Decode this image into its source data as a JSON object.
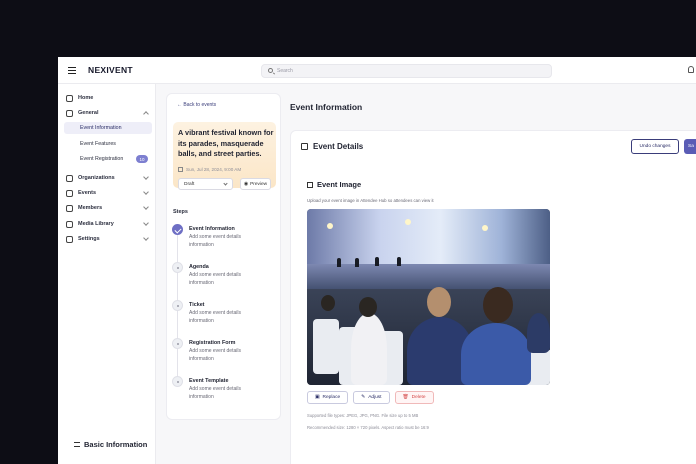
{
  "topbar": {
    "brand": "NEXIVENT",
    "search_placeholder": "Search"
  },
  "sidebar": {
    "items": [
      {
        "label": "Home",
        "icon": "home-icon"
      },
      {
        "label": "General",
        "icon": "chart-icon",
        "expanded": true
      },
      {
        "label": "Organizations",
        "icon": "building-icon"
      },
      {
        "label": "Events",
        "icon": "calendar-icon"
      },
      {
        "label": "Members",
        "icon": "users-icon"
      },
      {
        "label": "Media Library",
        "icon": "folder-icon"
      },
      {
        "label": "Settings",
        "icon": "gear-icon"
      }
    ],
    "sub_items": [
      {
        "label": "Event Information",
        "active": true
      },
      {
        "label": "Event Features"
      },
      {
        "label": "Event Registration",
        "badge": "10"
      }
    ]
  },
  "steps_panel": {
    "back_label": "Back to events",
    "hero_title": "A vibrant festival known for its parades, masquerade balls, and street parties.",
    "hero_date": "Sun, Jul 28, 2024, 9:00 AM",
    "status_value": "Draft",
    "preview_label": "Preview",
    "steps_title": "Steps",
    "steps": [
      {
        "title": "Event Information",
        "desc": "Add some event details information",
        "done": true
      },
      {
        "title": "Agenda",
        "desc": "Add some event details information",
        "done": false
      },
      {
        "title": "Ticket",
        "desc": "Add some event details information",
        "done": false
      },
      {
        "title": "Registration Form",
        "desc": "Add some event details information",
        "done": false
      },
      {
        "title": "Event Template",
        "desc": "Add some event details information",
        "done": false
      }
    ]
  },
  "main": {
    "page_title": "Event Information",
    "details_title": "Event Details",
    "undo_label": "Undo changes",
    "save_label": "Sa",
    "image_section": {
      "title": "Event Image",
      "hint": "Upload your event image in Attendee Hub so attendees can view it",
      "actions": [
        "Replace",
        "Adjust",
        "Delete"
      ],
      "note_types": "Supported file types: JPEG, JPG, PNG. File size up to 5 MB",
      "note_size": "Recommended size: 1280 × 720 pixels. Aspect ratio must be 16:9"
    },
    "basic_title": "Basic Information"
  },
  "colors": {
    "accent": "#5a5cb5",
    "hero_bg": "#fbe6c7",
    "danger": "#d54848"
  }
}
